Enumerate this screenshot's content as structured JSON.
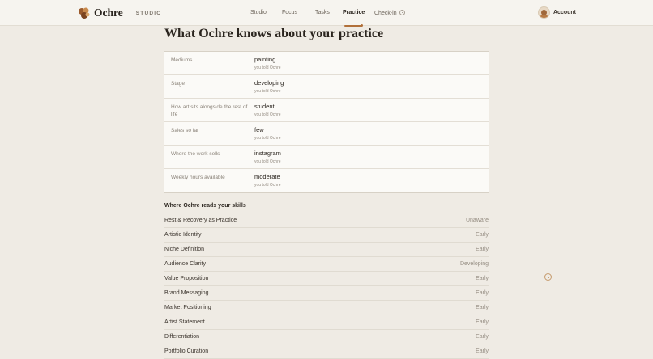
{
  "header": {
    "brand": "Ochre",
    "sub_brand": "STUDIO",
    "nav": [
      "Studio",
      "Focus",
      "Tasks",
      "Practice",
      "Check-in"
    ],
    "active_nav": "Practice",
    "account": "Account"
  },
  "page": {
    "title": "What Ochre knows about your practice"
  },
  "profile": [
    {
      "label": "Mediums",
      "value": "painting",
      "source": "you told Ochre"
    },
    {
      "label": "Stage",
      "value": "developing",
      "source": "you told Ochre"
    },
    {
      "label": "How art sits alongside the rest of life",
      "value": "student",
      "source": "you told Ochre"
    },
    {
      "label": "Sales so far",
      "value": "few",
      "source": "you told Ochre"
    },
    {
      "label": "Where the work sells",
      "value": "instagram",
      "source": "you told Ochre"
    },
    {
      "label": "Weekly hours available",
      "value": "moderate",
      "source": "you told Ochre"
    }
  ],
  "skills_section": {
    "title": "Where Ochre reads your skills",
    "items": [
      {
        "name": "Rest & Recovery as Practice",
        "level": "Unaware"
      },
      {
        "name": "Artistic Identity",
        "level": "Early"
      },
      {
        "name": "Niche Definition",
        "level": "Early"
      },
      {
        "name": "Audience Clarity",
        "level": "Developing"
      },
      {
        "name": "Value Proposition",
        "level": "Early"
      },
      {
        "name": "Brand Messaging",
        "level": "Early"
      },
      {
        "name": "Market Positioning",
        "level": "Early"
      },
      {
        "name": "Artist Statement",
        "level": "Early"
      },
      {
        "name": "Differentiation",
        "level": "Early"
      },
      {
        "name": "Portfolio Curation",
        "level": "Early"
      }
    ]
  },
  "colors": {
    "accent": "#b1703a",
    "background": "#efebe4",
    "surface": "#fbfaf7"
  },
  "icons": {
    "logo": "ochre-blob-logo",
    "checkin": "circle-dot-icon",
    "floating": "circle-dot-icon"
  }
}
